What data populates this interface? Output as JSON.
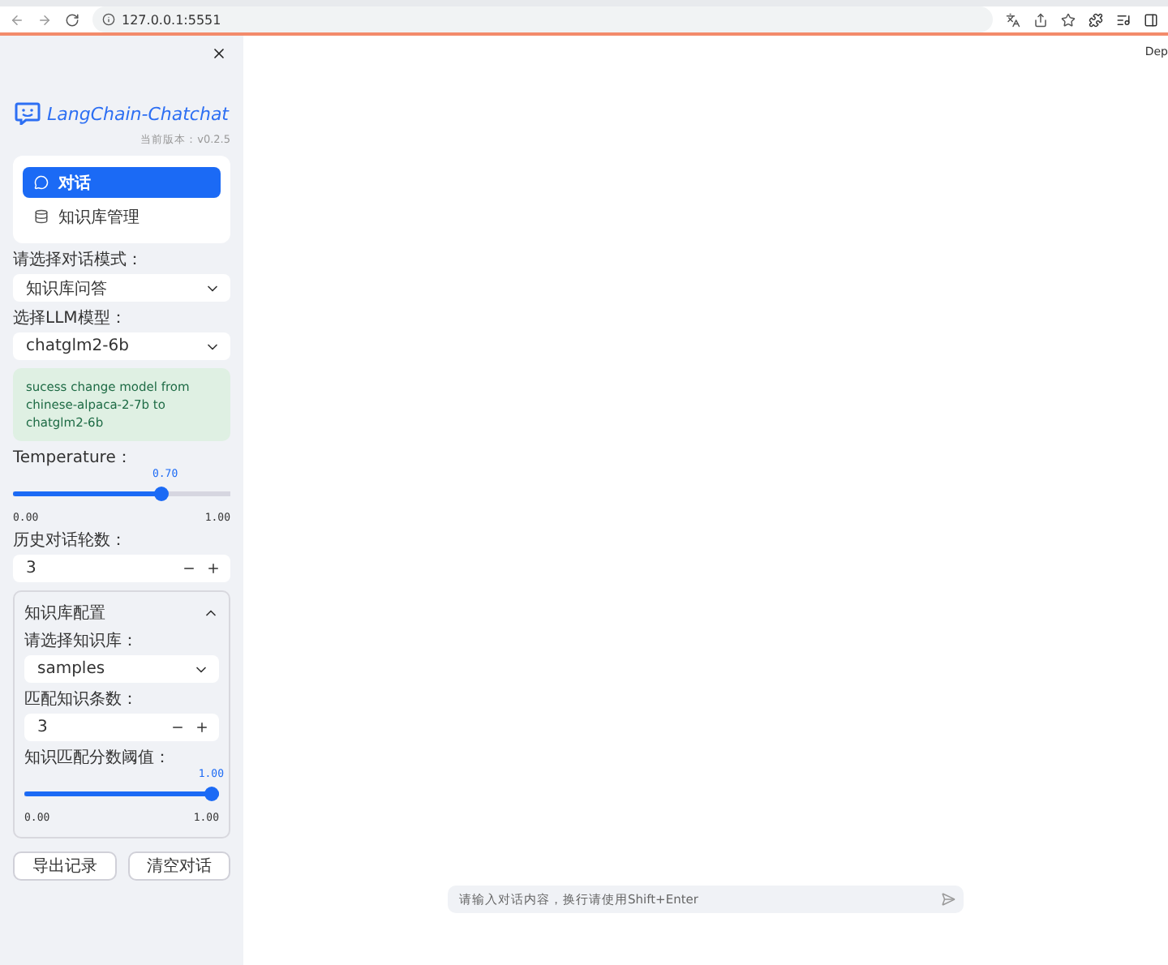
{
  "browser": {
    "url": "127.0.0.1:5551"
  },
  "header": {
    "menu_text": "Dep"
  },
  "sidebar": {
    "logo_text": "LangChain-Chatchat",
    "version": "当前版本：v0.2.5",
    "nav": [
      {
        "label": "对话",
        "selected": true,
        "kind": "chat"
      },
      {
        "label": "知识库管理",
        "selected": false,
        "kind": "database"
      }
    ],
    "mode_select": {
      "label": "请选择对话模式：",
      "value": "知识库问答"
    },
    "model_select": {
      "label": "选择LLM模型：",
      "value": "chatglm2-6b"
    },
    "success_message": "sucess change model from chinese-alpaca-2-7b to chatglm2-6b",
    "temperature": {
      "label": "Temperature：",
      "value": "0.70",
      "min": "0.00",
      "max": "1.00",
      "level": 0.7
    },
    "history_turns": {
      "label": "历史对话轮数：",
      "value": "3"
    },
    "kb_config": {
      "title": "知识库配置",
      "expanded": true,
      "kb_select": {
        "label": "请选择知识库：",
        "value": "samples"
      },
      "top_k": {
        "label": "匹配知识条数：",
        "value": "3"
      },
      "threshold": {
        "label": "知识匹配分数阈值：",
        "value": "1.00",
        "min": "0.00",
        "max": "1.00",
        "level": 1.0
      }
    },
    "buttons": [
      "导出记录",
      "清空对话"
    ]
  },
  "chat_input": {
    "placeholder": "请输入对话内容，换行请使用Shift+Enter"
  }
}
